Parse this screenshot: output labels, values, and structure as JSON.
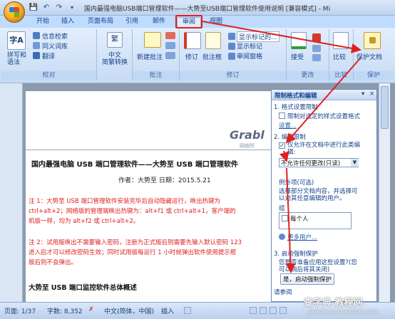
{
  "window": {
    "title": "国内最强电脑USB端口管理软件——大势至USB端口管理软件使用说明 [兼容模式] - Mi"
  },
  "quick_access": {
    "save_icon": "save-icon",
    "undo_icon": "undo-icon",
    "redo_icon": "redo-icon"
  },
  "tabs": [
    "开始",
    "插入",
    "页面布局",
    "引用",
    "邮件",
    "审阅",
    "视图"
  ],
  "active_tab": "审阅",
  "ribbon": {
    "proofing": {
      "label": "校对",
      "spell_label": "拼写和\n语法",
      "spell_l1": "拼写和",
      "spell_l2": "语法",
      "research": "信息检索",
      "thesaurus": "同义词库",
      "translate": "翻译"
    },
    "chinese": {
      "label": "中文简繁转换",
      "label_l1": "中文",
      "label_l2": "简繁转换"
    },
    "comments": {
      "label": "批注",
      "new_comment": "新建批注"
    },
    "tracking": {
      "label": "修订",
      "track": "修订",
      "balloons": "批注框",
      "show_markup_state": "显示标记的...",
      "show_markup": "显示标记",
      "reviewing_pane": "审阅窗格"
    },
    "changes": {
      "label": "更改",
      "accept": "接受"
    },
    "compare": {
      "label": "比较",
      "compare": "比较"
    },
    "protect": {
      "label": "保护",
      "protect_doc": "保护文档"
    }
  },
  "document": {
    "header_brand": "Grabl",
    "header_sub": "网络所",
    "title": "国内最强电脑 USB 端口管理软件——大势至 USB 端口管理软件",
    "byline": "作者：大势至 日期：2015.5.21",
    "note1_line1": "注 1：大势至 USB 端口管理软件安装完毕后自动隐藏运行，唤出热键为",
    "note1_line2": "ctrl+alt+2；网络版的管理端唤出热键为：alt+f1 或 ctrl+alt+1，客户端的",
    "note1_line3": "机版一样，均为 alt+f2 或 ctrl+alt+2。",
    "note2_line1": "注 2：试用版唤出不需要输入密码，注册为正式版后则需要先输入默认密码 123",
    "note2_line2": "进入后才可以修改密码生效；同时试用版每运行 1 小时就弹出软件使用提示框",
    "note2_line3": "版后则不会弹出。",
    "section_heading": "大势至 USB 端口监控软件总体概述"
  },
  "pane": {
    "title": "限制格式和编辑",
    "s1_title": "1. 格式设置限制",
    "s1_checkbox": "限制对选定的样式设置格式",
    "s1_settings": "设置...",
    "s2_title": "2. 编辑限制",
    "s2_checkbox": "仅允许在文档中进行此类编辑:",
    "s2_checkbox_l1": "仅允许在文档中进行此类编",
    "s2_checkbox_l2": "辑:",
    "s2_select": "不允许任何更改(只读)",
    "exceptions_title": "例外项(可选)",
    "exceptions_desc_l1": "选择部分文档内容，并选择可",
    "exceptions_desc_l2": "以对其任意编辑的用户。",
    "group_label": "组",
    "everyone": "每个人",
    "more_users": "更多用户...",
    "s3_title": "3. 启动强制保护",
    "s3_desc_l1": "您是否准备应用这些设置?(您",
    "s3_desc_l2": "可以稍后将其关闭)",
    "s3_button": "是，启动强制保护",
    "see_also": "请参阅"
  },
  "status": {
    "page": "页面: 1/37",
    "words": "字数: 8,352",
    "language": "中文(简体，中国)",
    "mode": "插入"
  },
  "watermark": {
    "line1": "查字典 教程网",
    "line2": "jiaocheng.chazidian.com"
  },
  "colors": {
    "accent": "#15428b",
    "annotation_red": "#e02020",
    "note_text": "#e02020"
  }
}
